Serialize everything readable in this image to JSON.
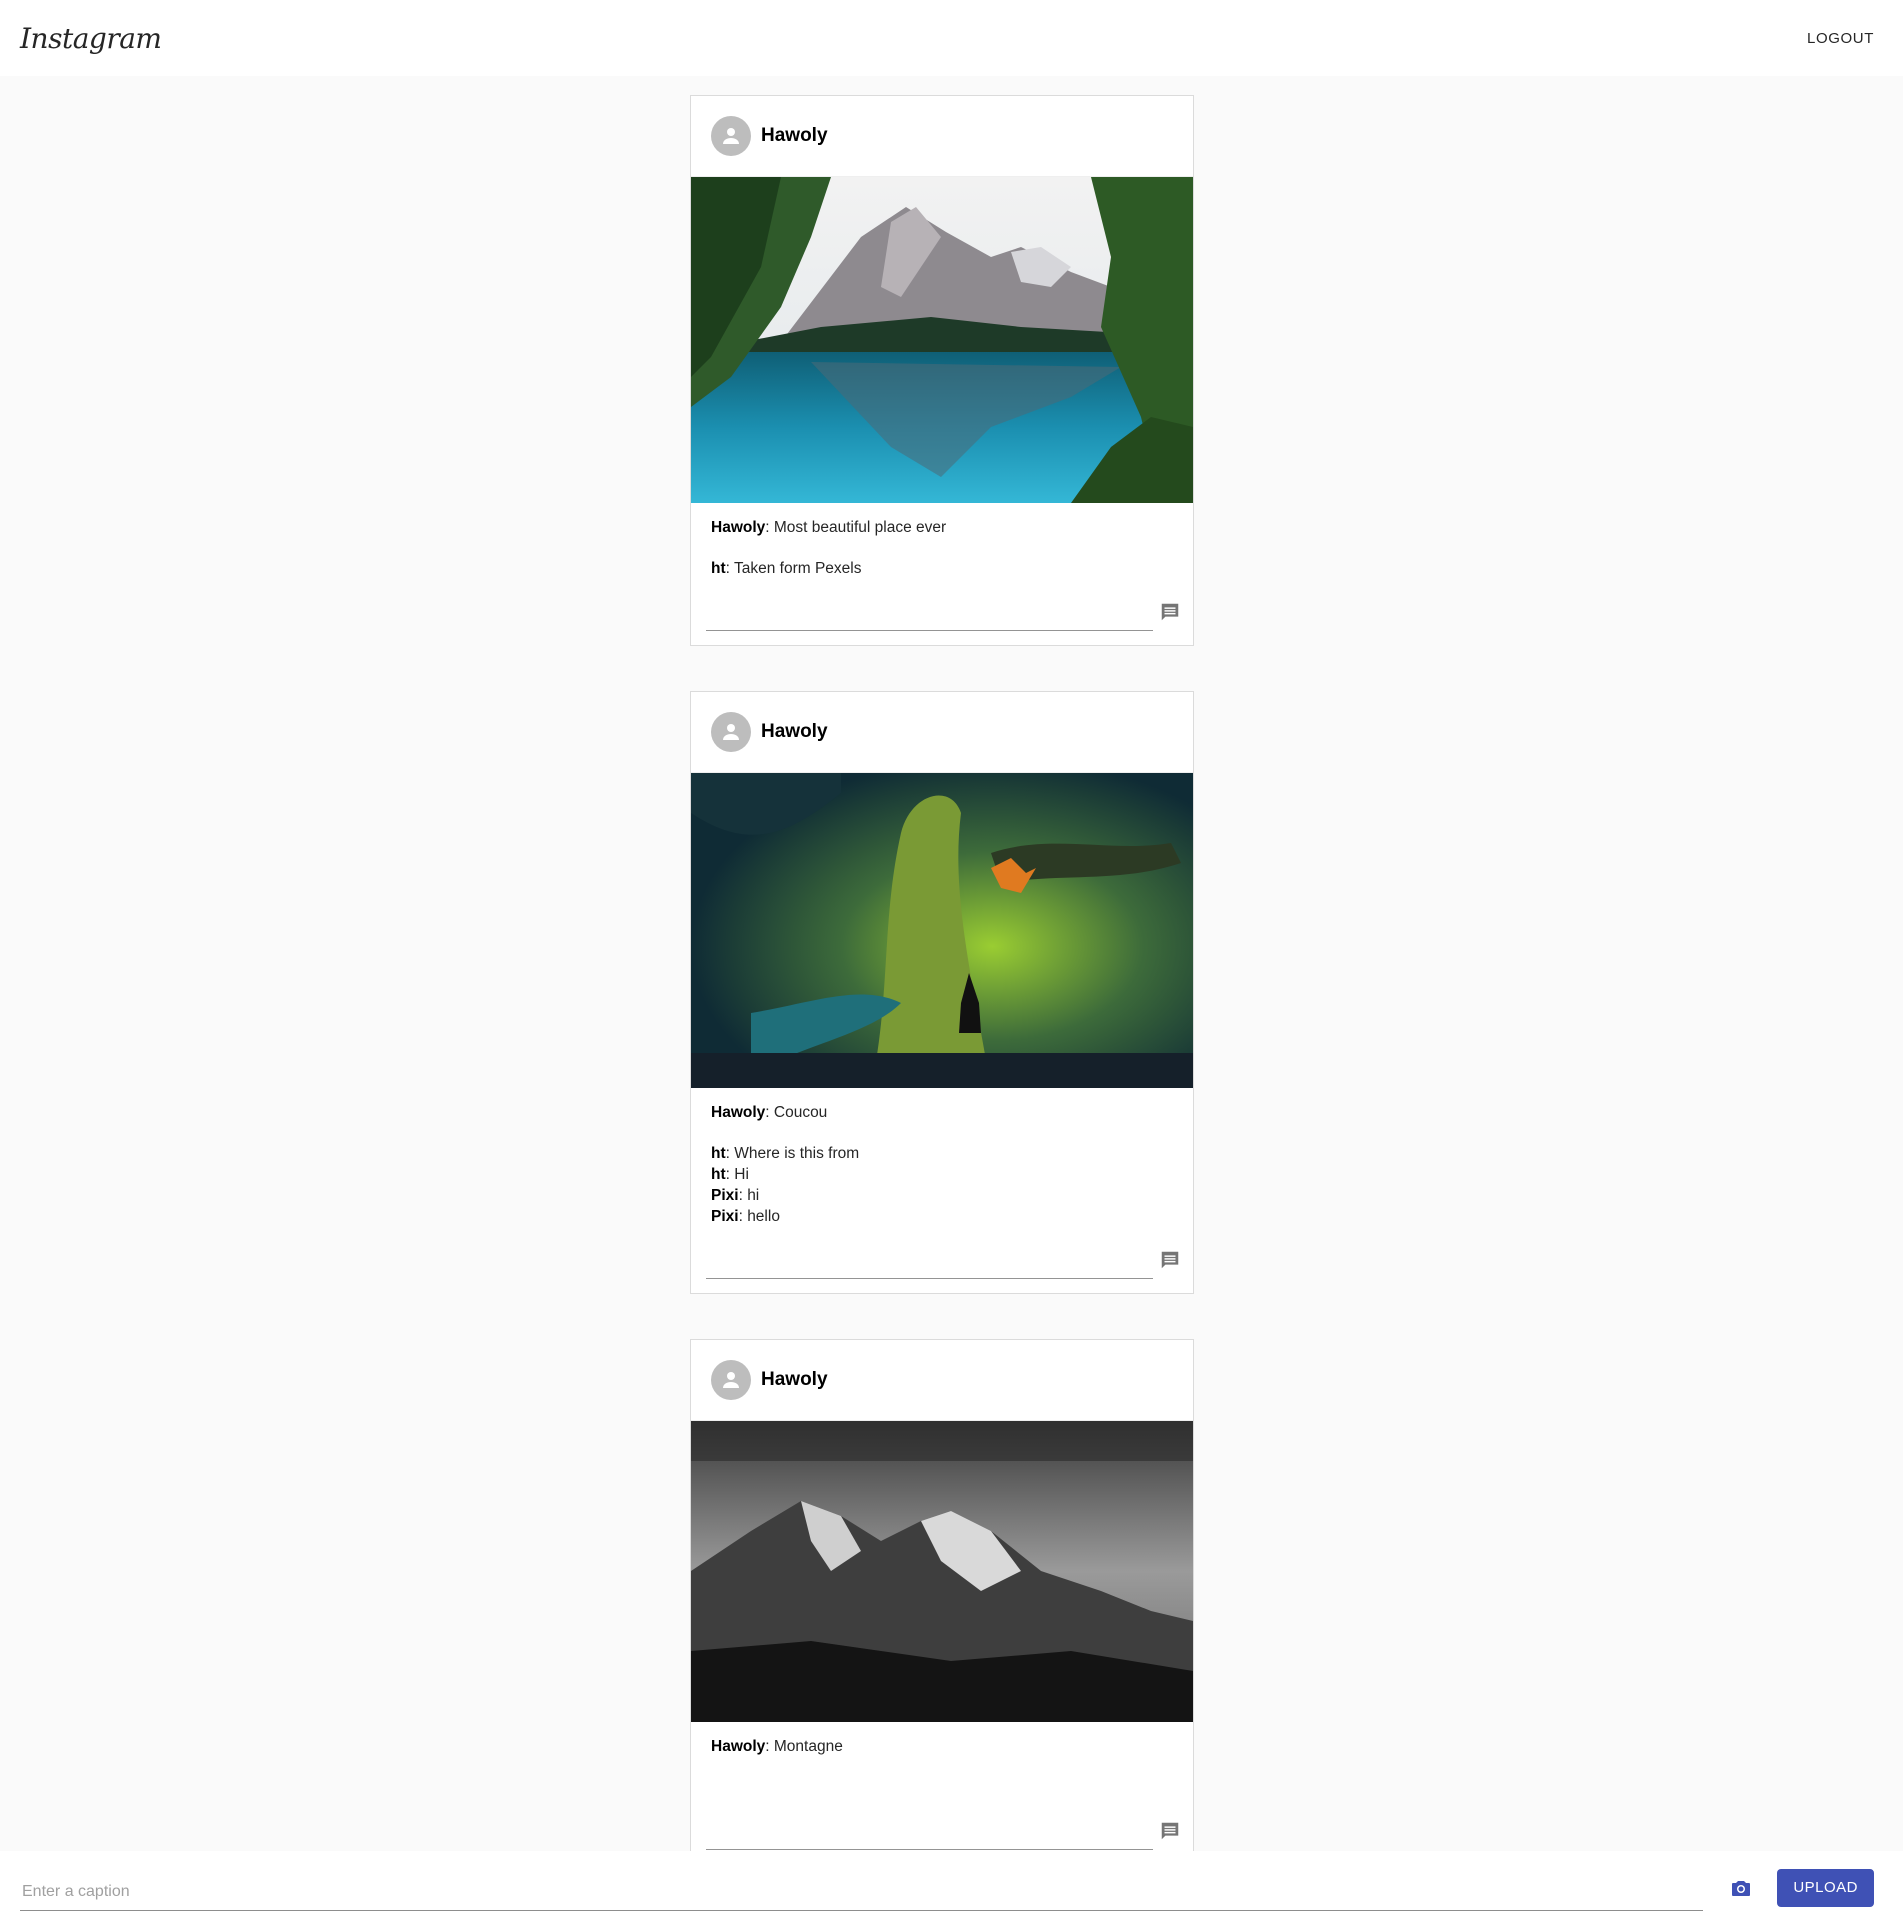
{
  "header": {
    "logo": "Instagram",
    "logout_label": "LOGOUT"
  },
  "posts": [
    {
      "username": "Hawoly",
      "image": "lake-mountain-photo",
      "caption_user": "Hawoly",
      "caption_text": ": Most beautiful place ever",
      "comments": [
        {
          "user": "ht",
          "text": ": Taken form Pexels"
        }
      ]
    },
    {
      "username": "Hawoly",
      "image": "fantasy-tree-dragon-painting",
      "caption_user": "Hawoly",
      "caption_text": ": Coucou",
      "comments": [
        {
          "user": "ht",
          "text": ": Where is this from"
        },
        {
          "user": "ht",
          "text": ": Hi"
        },
        {
          "user": "Pixi",
          "text": ": hi"
        },
        {
          "user": "Pixi",
          "text": ": hello"
        }
      ]
    },
    {
      "username": "Hawoly",
      "image": "black-white-mountain-photo",
      "caption_user": "Hawoly",
      "caption_text": ": Montagne",
      "comments": []
    }
  ],
  "upload": {
    "caption_placeholder": "Enter a caption",
    "camera_icon": "camera-icon",
    "upload_label": "UPLOAD"
  },
  "colors": {
    "accent": "#3f51b5",
    "background": "#fafafa",
    "icon_grey": "#757575"
  }
}
